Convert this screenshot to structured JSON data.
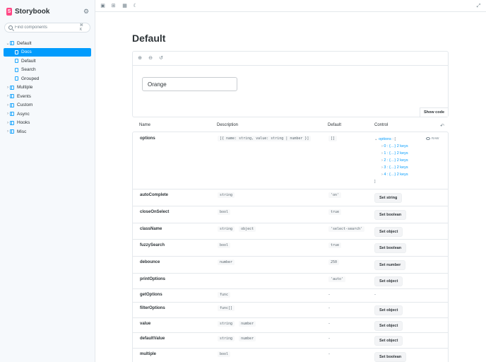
{
  "app": {
    "name": "Storybook",
    "logo_letter": "S",
    "accent": "#029cfd",
    "brand_color": "#ff4785"
  },
  "sidebar": {
    "search_placeholder": "Find components",
    "search_shortcut": "⌘ K",
    "tree": [
      {
        "label": "Default",
        "expanded": true
      },
      {
        "label": "Docs",
        "active": true
      },
      {
        "label": "Default"
      },
      {
        "label": "Search"
      },
      {
        "label": "Grouped"
      },
      {
        "label": "Multiple"
      },
      {
        "label": "Events"
      },
      {
        "label": "Custom"
      },
      {
        "label": "Async"
      },
      {
        "label": "Hooks"
      },
      {
        "label": "Misc"
      }
    ]
  },
  "main": {
    "title": "Default",
    "preview": {
      "select_value": "Orange",
      "show_code": "Show code"
    },
    "args_table": {
      "headers": [
        "Name",
        "Description",
        "Default",
        "Control"
      ],
      "options_row": {
        "name": "options",
        "type": "[{ name: string, value: string | number }]",
        "default": "[]",
        "raw_label": "RAW",
        "json_key": "options",
        "json_open": "[",
        "json_close": "]",
        "items": [
          "0 : {…} 2 keys",
          "1 : {…} 2 keys",
          "2 : {…} 2 keys",
          "3 : {…} 2 keys",
          "4 : {…} 2 keys"
        ]
      },
      "rows": [
        {
          "name": "autoComplete",
          "types": [
            "string"
          ],
          "default": "'on'",
          "control": "Set string"
        },
        {
          "name": "closeOnSelect",
          "types": [
            "bool"
          ],
          "default": "true",
          "control": "Set boolean"
        },
        {
          "name": "className",
          "types": [
            "string",
            "object"
          ],
          "default": "'select-search'",
          "control": "Set object"
        },
        {
          "name": "fuzzySearch",
          "types": [
            "bool"
          ],
          "default": "true",
          "control": "Set boolean"
        },
        {
          "name": "debounce",
          "types": [
            "number"
          ],
          "default": "250",
          "control": "Set number"
        },
        {
          "name": "printOptions",
          "types": [],
          "default": "'auto'",
          "control": "Set object"
        },
        {
          "name": "getOptions",
          "types": [
            "func"
          ],
          "default": "-",
          "control": "-"
        },
        {
          "name": "filterOptions",
          "types": [
            "func[]"
          ],
          "default": "-",
          "control": "Set object"
        },
        {
          "name": "value",
          "types": [
            "string",
            "number"
          ],
          "default": "-",
          "control": "Set object"
        },
        {
          "name": "defaultValue",
          "types": [
            "string",
            "number"
          ],
          "default": "-",
          "control": "Set object"
        },
        {
          "name": "multiple",
          "types": [
            "bool"
          ],
          "default": "-",
          "control": "Set boolean"
        }
      ]
    }
  }
}
